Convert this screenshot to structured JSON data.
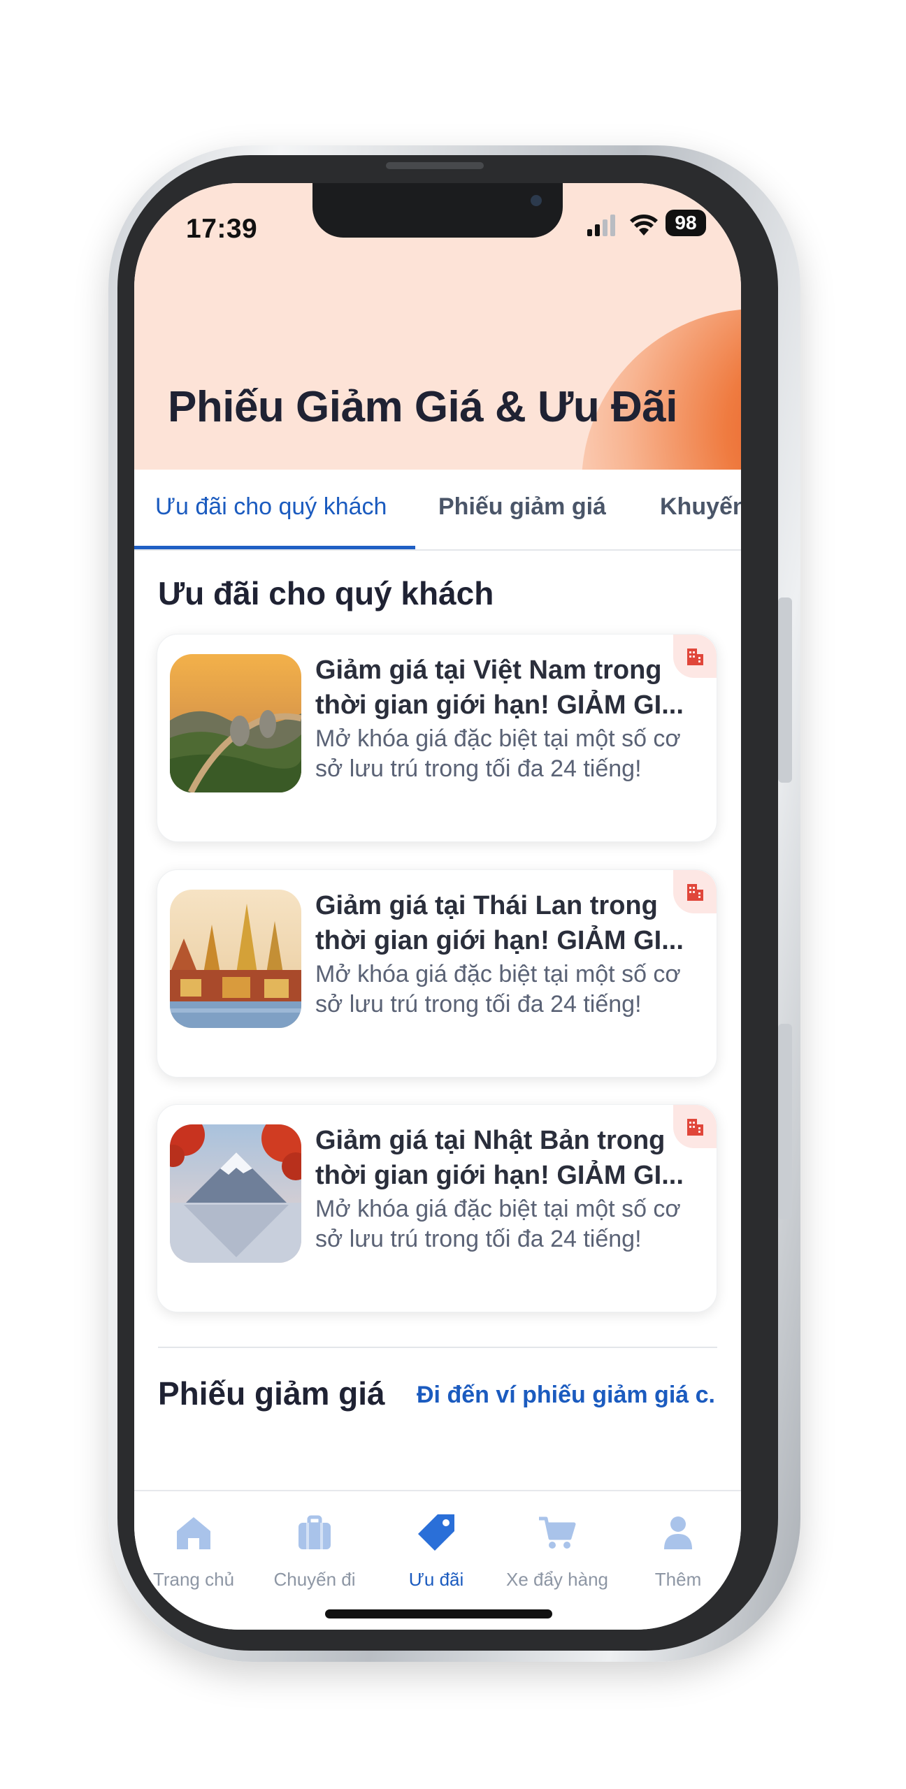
{
  "status_bar": {
    "time": "17:39",
    "battery": "98"
  },
  "header": {
    "title": "Phiếu Giảm Giá & Ưu Đãi"
  },
  "tabs": [
    {
      "label": "Ưu đãi cho quý khách"
    },
    {
      "label": "Phiếu giảm giá"
    },
    {
      "label": "Khuyến"
    }
  ],
  "offers_section": {
    "title": "Ưu đãi cho quý khách",
    "items": [
      {
        "title": "Giảm giá tại Việt Nam trong thời gian giới hạn! GIẢM GI...",
        "description": "Mở khóa giá đặc biệt tại một số cơ sở lưu trú trong tối đa 24 tiếng!",
        "badge_icon": "hotel-icon"
      },
      {
        "title": "Giảm giá tại Thái Lan trong thời gian giới hạn! GIẢM GI...",
        "description": "Mở khóa giá đặc biệt tại một số cơ sở lưu trú trong tối đa 24 tiếng!",
        "badge_icon": "hotel-icon"
      },
      {
        "title": "Giảm giá tại Nhật Bản trong thời gian giới hạn! GIẢM GI...",
        "description": "Mở khóa giá đặc biệt tại một số cơ sở lưu trú trong tối đa 24 tiếng!",
        "badge_icon": "hotel-icon"
      }
    ]
  },
  "vouchers_section": {
    "title": "Phiếu giảm giá",
    "link": "Đi đến ví phiếu giảm giá c..."
  },
  "bottom_nav": [
    {
      "label": "Trang chủ",
      "icon": "home-icon"
    },
    {
      "label": "Chuyến đi",
      "icon": "suitcase-icon"
    },
    {
      "label": "Ưu đãi",
      "icon": "tag-icon"
    },
    {
      "label": "Xe đẩy hàng",
      "icon": "cart-icon"
    },
    {
      "label": "Thêm",
      "icon": "user-icon"
    }
  ],
  "colors": {
    "accent": "#1b5bbf",
    "hero_background": "#fde3d7",
    "hero_orange": "#e5531d",
    "badge_red": "#e0463a"
  }
}
